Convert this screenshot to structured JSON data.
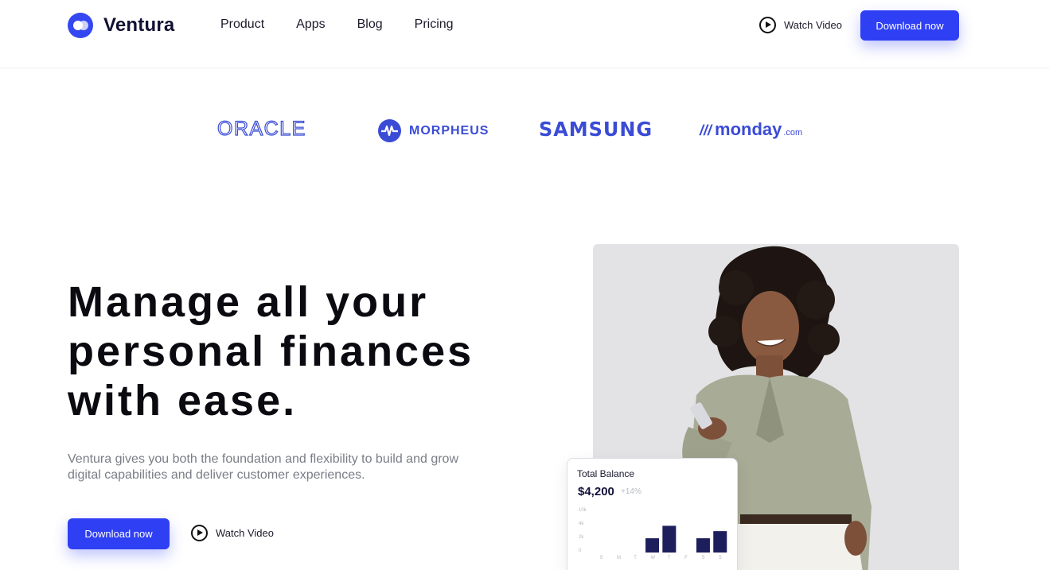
{
  "brand": {
    "name": "Ventura",
    "accent": "#2f3ff4"
  },
  "nav": {
    "items": [
      "Product",
      "Apps",
      "Blog",
      "Pricing"
    ]
  },
  "header": {
    "watch_label": "Watch Video",
    "download_label": "Download now"
  },
  "logos": {
    "oracle": "ORACLE",
    "morpheus": "MORPHEUS",
    "samsung": "SAMSUNG",
    "monday": "monday",
    "monday_suffix": ".com"
  },
  "hero": {
    "title_lines": [
      "Manage all your",
      "personal finances",
      "with ease."
    ],
    "subtitle_lines": [
      "Ventura gives you both the foundation and flexibility to build and grow",
      "digital capabilities and deliver customer experiences."
    ],
    "download_label": "Download now",
    "watch_label": "Watch Video"
  },
  "balance": {
    "title": "Total Balance",
    "amount": "$4,200",
    "change": "+14%"
  },
  "chart_data": {
    "type": "bar",
    "categories": [
      "S",
      "M",
      "T",
      "W",
      "T",
      "F",
      "S",
      "S"
    ],
    "values": [
      0,
      0,
      0,
      3.2,
      6.0,
      0,
      3.2,
      4.8
    ],
    "ytick_labels": [
      "10k",
      "4k",
      "2k",
      "0"
    ],
    "ylim": [
      0,
      10
    ],
    "bar_color": "#1c1f5c"
  }
}
